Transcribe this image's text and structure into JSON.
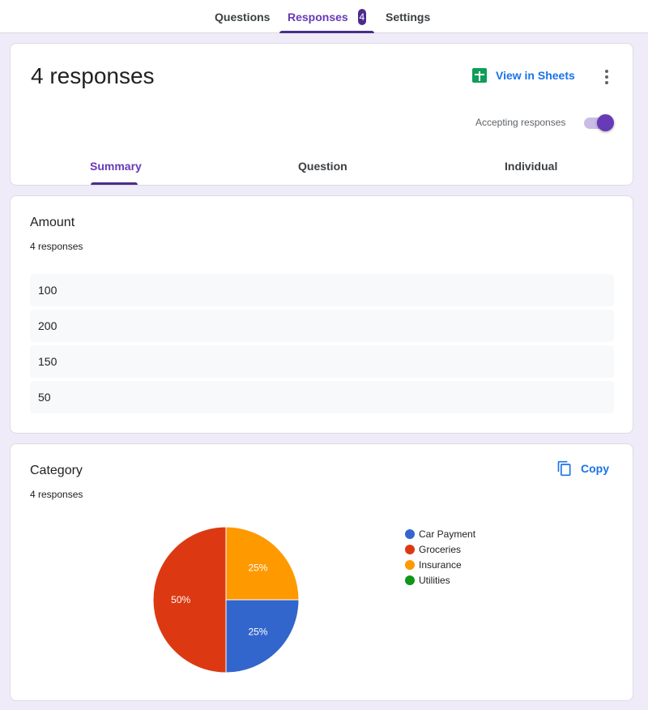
{
  "top_tabs": [
    {
      "label": "Questions",
      "active": false
    },
    {
      "label": "Responses",
      "active": true,
      "badge": "4"
    },
    {
      "label": "Settings",
      "active": false
    }
  ],
  "header": {
    "title": "4 responses",
    "view_in_sheets": "View in Sheets",
    "more_icon": "more-vert-icon",
    "accepting_label": "Accepting responses",
    "accepting_on": true,
    "subtabs": [
      {
        "label": "Summary",
        "active": true
      },
      {
        "label": "Question",
        "active": false
      },
      {
        "label": "Individual",
        "active": false
      }
    ]
  },
  "questions": [
    {
      "title": "Amount",
      "count": "4 responses",
      "responses": [
        "100",
        "200",
        "150",
        "50"
      ]
    },
    {
      "title": "Category",
      "count": "4 responses",
      "copy_label": "Copy"
    }
  ],
  "colors": {
    "accent": "#673ab7",
    "badge": "#4a2c8c",
    "link": "#1a73e8",
    "sheets": "#0f9d58"
  },
  "chart_data": {
    "type": "pie",
    "title": "Category",
    "categories": [
      "Car Payment",
      "Groceries",
      "Insurance",
      "Utilities"
    ],
    "values": [
      1,
      2,
      1,
      0
    ],
    "percent_labels": [
      "25%",
      "50%",
      "25%",
      ""
    ],
    "colors": [
      "#3366cc",
      "#dc3912",
      "#ff9900",
      "#109618"
    ],
    "legend": "right"
  }
}
